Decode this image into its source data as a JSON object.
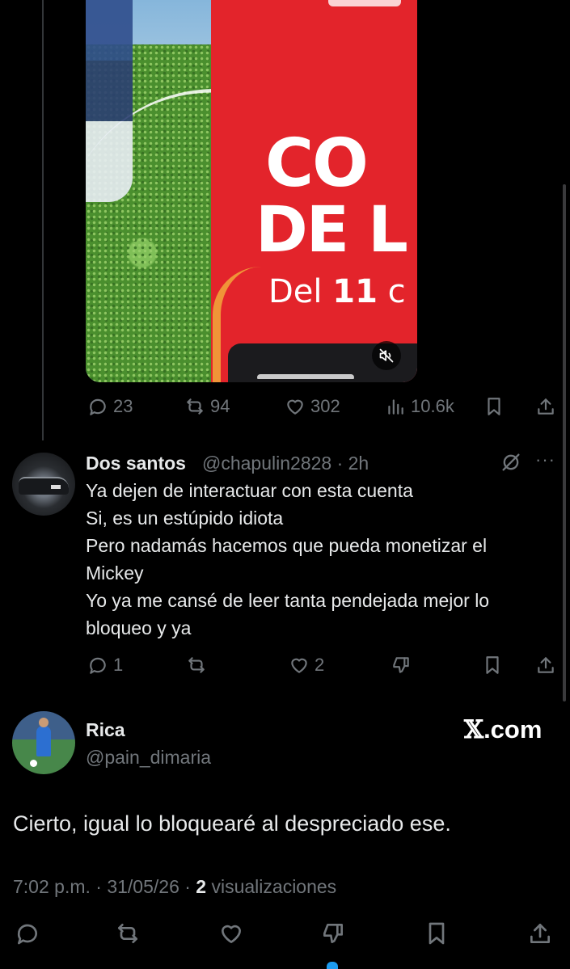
{
  "media": {
    "text_line1": "CO",
    "text_line2": "DE L",
    "text_line3_pre": "Del ",
    "text_line3_bold": "11",
    "text_line3_post": " c"
  },
  "top_tweet_actions": {
    "replies": "23",
    "retweets": "94",
    "likes": "302",
    "views": "10.6k"
  },
  "reply": {
    "name": "Dos santos",
    "handle": "@chapulin2828",
    "time": "· 2h",
    "lines": [
      "Ya dejen de interactuar con esta cuenta",
      "Si, es un estúpido idiota",
      "Pero nadamás hacemos que pueda monetizar el",
      "Mickey",
      "Yo ya me cansé de leer tanta pendejada mejor lo",
      "bloqueo y ya"
    ],
    "more": "···",
    "replies": "1",
    "likes": "2"
  },
  "main_tweet": {
    "name": "Rica",
    "handle": "@pain_dimaria",
    "brand_x": "𝕏",
    "brand_rest": ".com",
    "text": "Cierto, igual lo bloquearé al despreciado ese.",
    "time": "7:02 p.m. · 31/05/26 · ",
    "views_count": "2",
    "views_label": " visualizaciones"
  },
  "icons": {
    "reply": "reply-icon",
    "retweet": "retweet-icon",
    "like": "heart-icon",
    "views": "views-icon",
    "bookmark": "bookmark-icon",
    "share": "share-icon",
    "dislike": "dislike-icon",
    "grok": "grok-icon",
    "mute": "muted-speaker-icon"
  },
  "colors": {
    "background": "#000000",
    "text": "#e7e9ea",
    "secondary": "#71767b",
    "accent": "#1d9bf0",
    "banner_red": "#e3242b"
  }
}
